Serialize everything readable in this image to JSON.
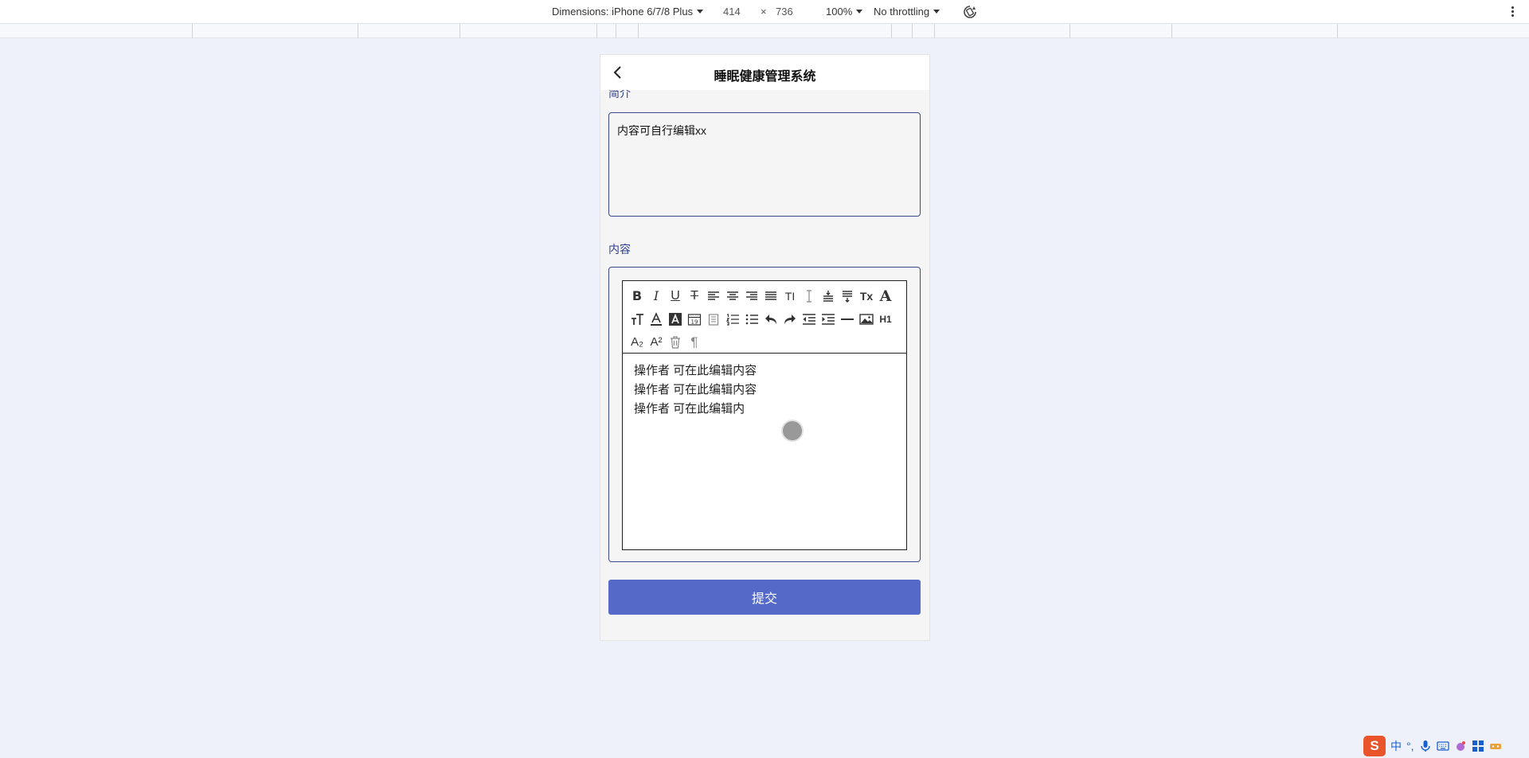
{
  "devtools": {
    "dimensions_label": "Dimensions: iPhone 6/7/8 Plus",
    "width": "414",
    "times": "×",
    "height": "736",
    "zoom": "100%",
    "throttling": "No throttling"
  },
  "app": {
    "title": "睡眠健康管理系统",
    "intro_label": "简介",
    "intro_value": "内容可自行编辑xx",
    "content_label": "内容",
    "editor_lines": [
      "操作者  可在此编辑内容",
      "操作者  可在此编辑内容",
      "操作者  可在此编辑内"
    ],
    "toolbar_text": {
      "bold": "B",
      "italic": "I",
      "underline": "U",
      "strike": "T",
      "fontsize": "TI",
      "fontfamily": "A",
      "h1": "H1",
      "sub": "A₂",
      "sup": "A²",
      "date": "19",
      "paragraph": "¶",
      "clear": "Tx"
    },
    "submit_label": "提交"
  },
  "tray": {
    "ime_logo": "S",
    "ime_lang": "中",
    "ime_punct": "°,"
  }
}
